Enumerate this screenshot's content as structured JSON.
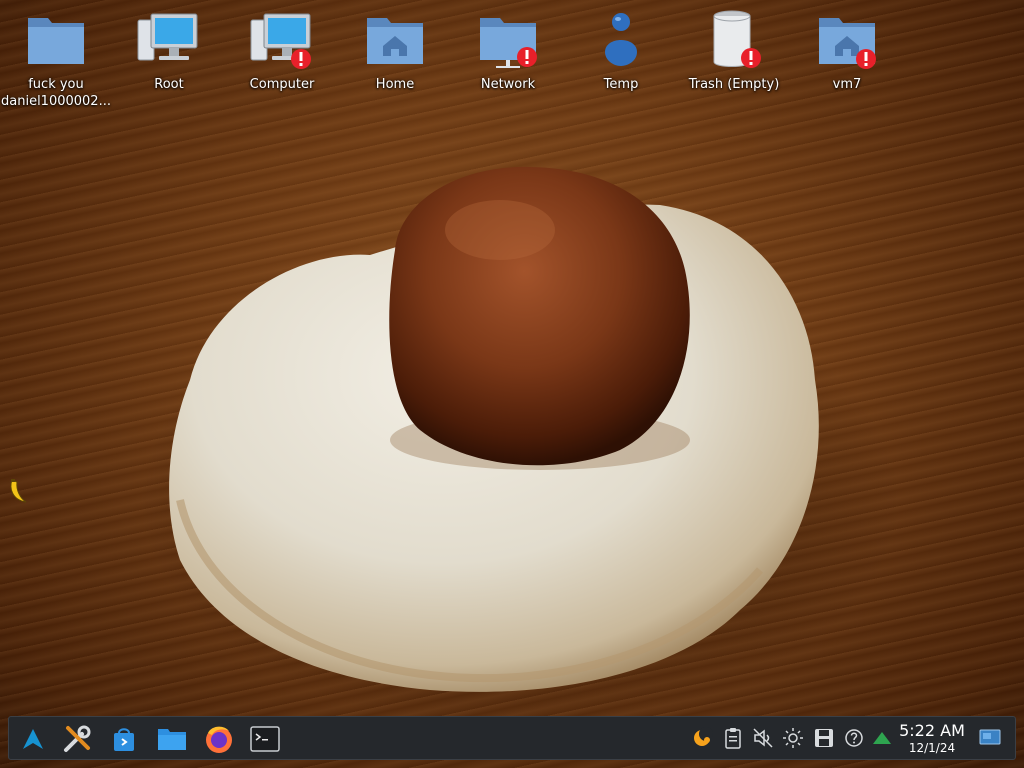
{
  "desktop": {
    "icons": [
      {
        "label": "fuck you daniel1000002...",
        "icon": "folder-icon"
      },
      {
        "label": "Root",
        "icon": "computer-icon"
      },
      {
        "label": "Computer",
        "icon": "computer-icon"
      },
      {
        "label": "Home",
        "icon": "home-folder-icon"
      },
      {
        "label": "Network",
        "icon": "network-folder-icon"
      },
      {
        "label": "Temp",
        "icon": "user-icon"
      },
      {
        "label": "Trash (Empty)",
        "icon": "trash-icon"
      },
      {
        "label": "vm7",
        "icon": "home-folder-icon"
      }
    ],
    "wallpaper": "meatball-on-bun-photo"
  },
  "taskbar": {
    "launchers": [
      "application-launcher-icon",
      "system-settings-icon",
      "discover-store-icon",
      "file-manager-icon",
      "firefox-icon",
      "terminal-icon"
    ],
    "tray": [
      "night-color-icon",
      "clipboard-icon",
      "volume-muted-icon",
      "brightness-icon",
      "storage-icon",
      "help-icon",
      "network-icon"
    ],
    "clock": {
      "time": "5:22 AM",
      "date": "12/1/24"
    },
    "show_desktop": "show-desktop-icon"
  },
  "colors": {
    "folder": "#6f9fd4",
    "taskbar": "#25282c",
    "warning": "#e8202a",
    "network_green": "#2ea44f"
  }
}
